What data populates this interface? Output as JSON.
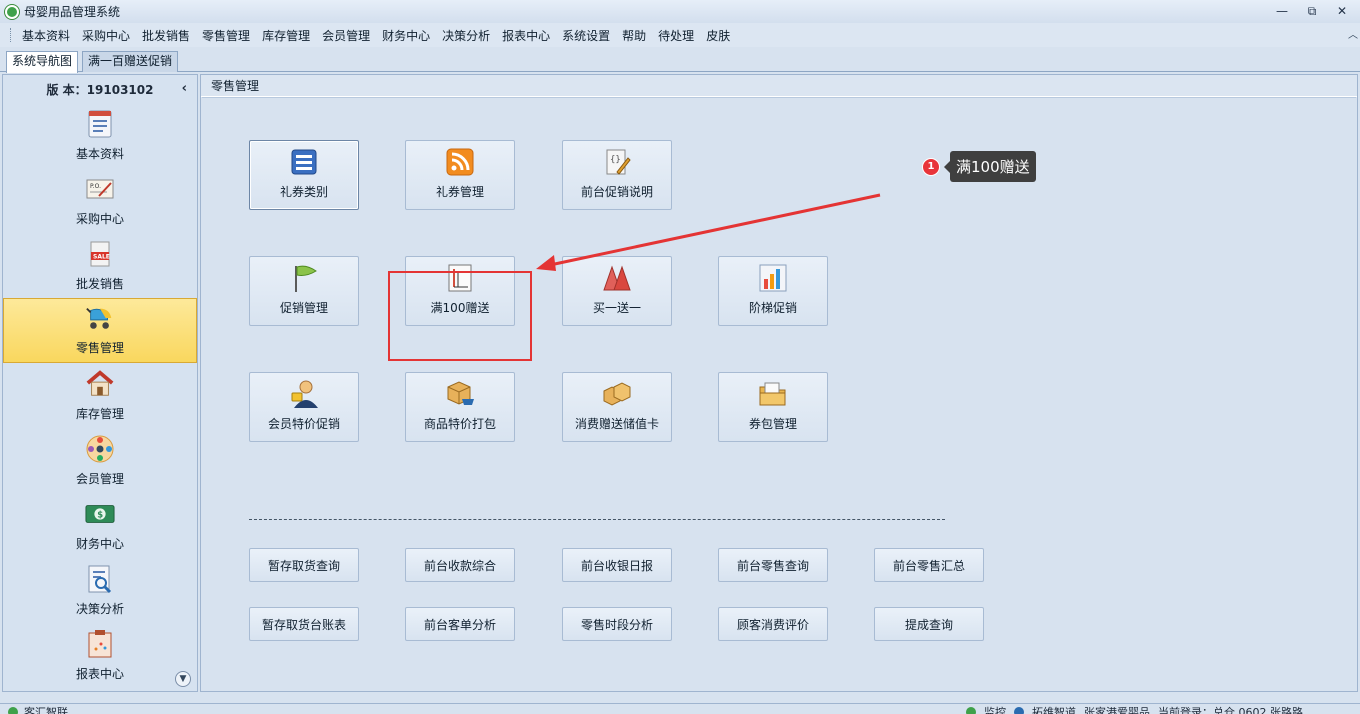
{
  "window": {
    "title": "母婴用品管理系统",
    "controls": {
      "minimize": "—",
      "restore": "⧉",
      "close": "✕"
    }
  },
  "menu": {
    "items": [
      "基本资料",
      "采购中心",
      "批发销售",
      "零售管理",
      "库存管理",
      "会员管理",
      "财务中心",
      "决策分析",
      "报表中心",
      "系统设置",
      "帮助",
      "待处理",
      "皮肤"
    ]
  },
  "tabs": [
    {
      "label": "系统导航图",
      "active": true
    },
    {
      "label": "满一百赠送促销",
      "active": false
    }
  ],
  "sidebar": {
    "version": "版 本：19103102",
    "items": [
      {
        "label": "基本资料",
        "icon": "document-icon"
      },
      {
        "label": "采购中心",
        "icon": "purchase-order-icon"
      },
      {
        "label": "批发销售",
        "icon": "sale-tag-icon"
      },
      {
        "label": "零售管理",
        "icon": "stroller-icon",
        "active": true
      },
      {
        "label": "库存管理",
        "icon": "house-icon"
      },
      {
        "label": "会员管理",
        "icon": "members-icon"
      },
      {
        "label": "财务中心",
        "icon": "money-icon"
      },
      {
        "label": "决策分析",
        "icon": "analysis-icon"
      },
      {
        "label": "报表中心",
        "icon": "report-icon"
      }
    ]
  },
  "main": {
    "title": "零售管理",
    "feature_rows": [
      [
        {
          "label": "礼券类别",
          "icon": "list-icon",
          "selected": true
        },
        {
          "label": "礼券管理",
          "icon": "rss-icon"
        },
        {
          "label": "前台促销说明",
          "icon": "edit-note-icon"
        }
      ],
      [
        {
          "label": "促销管理",
          "icon": "flag-icon"
        },
        {
          "label": "满100赠送",
          "icon": "chart-sheet-icon"
        },
        {
          "label": "买一送一",
          "icon": "pyramid-icon"
        },
        {
          "label": "阶梯促销",
          "icon": "bar-chart-icon"
        }
      ],
      [
        {
          "label": "会员特价促销",
          "icon": "member-person-icon"
        },
        {
          "label": "商品特价打包",
          "icon": "package-cart-icon"
        },
        {
          "label": "消费赠送储值卡",
          "icon": "boxes-icon"
        },
        {
          "label": "券包管理",
          "icon": "folder-icon"
        }
      ]
    ],
    "small_rows": [
      [
        "暂存取货查询",
        "前台收款综合",
        "前台收银日报",
        "前台零售查询",
        "前台零售汇总"
      ],
      [
        "暂存取货台账表",
        "前台客单分析",
        "零售时段分析",
        "顾客消费评价",
        "提成查询"
      ]
    ]
  },
  "annotation": {
    "badge": "1",
    "text": "满100赠送"
  },
  "status": {
    "left": "客汇智联",
    "right": [
      "监控",
      "拓维智道",
      "张家港爱婴品",
      "当前登录：总仓 0602 张路路"
    ]
  },
  "colors": {
    "accent": "#f9d75e",
    "highlight": "#e43434",
    "callout_bg": "#3f3f3f",
    "badge_bg": "#e8343a"
  }
}
